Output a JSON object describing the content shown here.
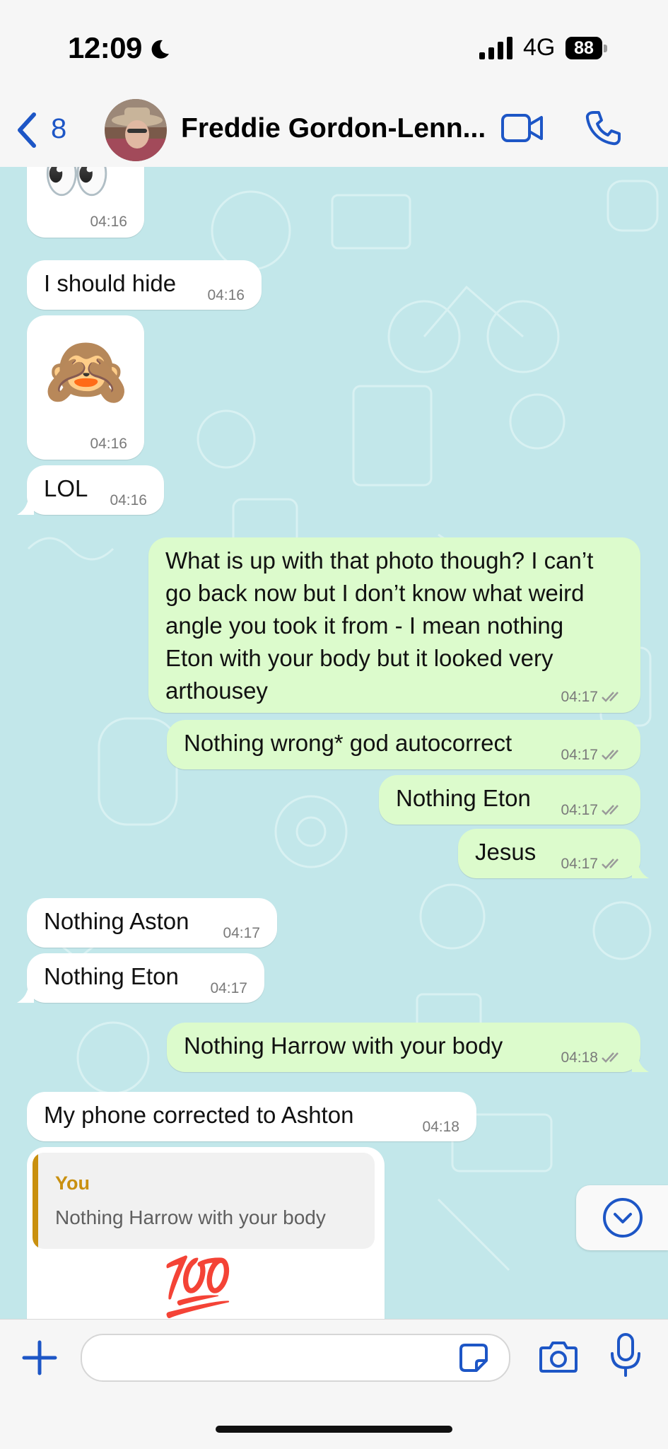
{
  "status_bar": {
    "time": "12:09",
    "network": "4G",
    "battery": "88"
  },
  "header": {
    "back_count": "8",
    "contact_name": "Freddie Gordon-Lenn..."
  },
  "colors": {
    "accent": "#1d56c6",
    "incoming": "#ffffff",
    "outgoing": "#dcfbcc",
    "chat_bg": "#c2e7ea",
    "quote_accent": "#c9900f"
  },
  "messages": [
    {
      "direction": "in",
      "type": "emoji",
      "emoji": "👀",
      "time": "04:16"
    },
    {
      "direction": "in",
      "type": "text",
      "text": "I should hide",
      "time": "04:16"
    },
    {
      "direction": "in",
      "type": "emoji",
      "emoji": "🙈",
      "time": "04:16"
    },
    {
      "direction": "in",
      "type": "text",
      "text": "LOL",
      "time": "04:16"
    },
    {
      "direction": "out",
      "type": "text",
      "lines": [
        "What is up with that photo though? I can’t",
        "go back now but I don’t know what weird",
        "angle you took it from - I mean nothing",
        "Eton with your body but it looked very",
        "arthousey"
      ],
      "time": "04:17",
      "status": "read"
    },
    {
      "direction": "out",
      "type": "text",
      "text": "Nothing wrong* god autocorrect",
      "time": "04:17",
      "status": "read"
    },
    {
      "direction": "out",
      "type": "text",
      "text": "Nothing Eton",
      "time": "04:17",
      "status": "read"
    },
    {
      "direction": "out",
      "type": "text",
      "text": "Jesus",
      "time": "04:17",
      "status": "read"
    },
    {
      "direction": "in",
      "type": "text",
      "text": "Nothing Aston",
      "time": "04:17"
    },
    {
      "direction": "in",
      "type": "text",
      "text": "Nothing Eton",
      "time": "04:17"
    },
    {
      "direction": "out",
      "type": "text",
      "text": "Nothing Harrow with your body",
      "time": "04:18",
      "status": "read"
    },
    {
      "direction": "in",
      "type": "text",
      "text": "My phone corrected to Ashton",
      "time": "04:18"
    },
    {
      "direction": "in",
      "type": "reply",
      "quote_author": "You",
      "quote_text": "Nothing Harrow with your body",
      "emoji": "💯"
    }
  ],
  "input": {
    "value": ""
  }
}
